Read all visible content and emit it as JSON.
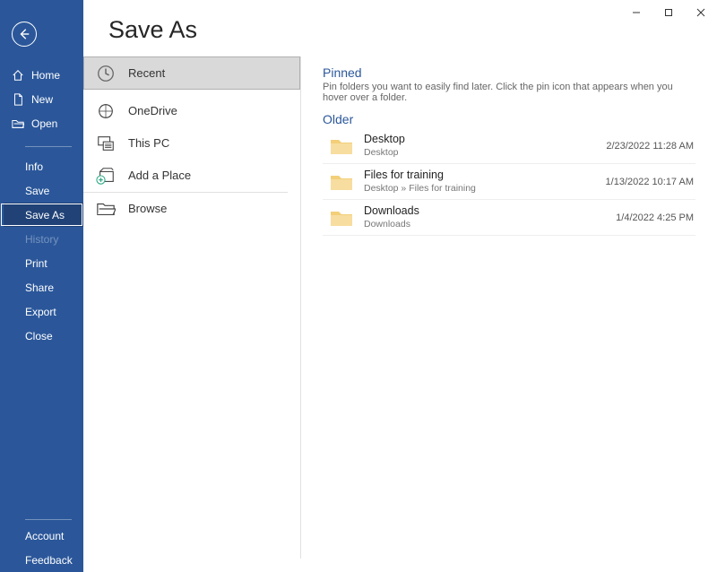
{
  "page_title": "Save As",
  "sidebar": {
    "top": [
      {
        "label": "Home",
        "icon": "home"
      },
      {
        "label": "New",
        "icon": "new"
      },
      {
        "label": "Open",
        "icon": "open"
      }
    ],
    "mid": [
      {
        "label": "Info",
        "state": ""
      },
      {
        "label": "Save",
        "state": ""
      },
      {
        "label": "Save As",
        "state": "selected"
      },
      {
        "label": "History",
        "state": "disabled"
      },
      {
        "label": "Print",
        "state": ""
      },
      {
        "label": "Share",
        "state": ""
      },
      {
        "label": "Export",
        "state": ""
      },
      {
        "label": "Close",
        "state": ""
      }
    ],
    "bottom": [
      {
        "label": "Account"
      },
      {
        "label": "Feedback"
      }
    ]
  },
  "locations": [
    {
      "label": "Recent",
      "icon": "clock",
      "selected": true
    },
    {
      "label": "OneDrive",
      "icon": "onedrive",
      "selected": false
    },
    {
      "label": "This PC",
      "icon": "thispc",
      "selected": false
    },
    {
      "label": "Add a Place",
      "icon": "addplace",
      "selected": false
    },
    {
      "label": "Browse",
      "icon": "browse",
      "selected": false
    }
  ],
  "pinned": {
    "heading": "Pinned",
    "hint": "Pin folders you want to easily find later. Click the pin icon that appears when you hover over a folder."
  },
  "older": {
    "heading": "Older",
    "items": [
      {
        "name": "Desktop",
        "path": "Desktop",
        "time": "2/23/2022 11:28 AM"
      },
      {
        "name": "Files for training",
        "path": "Desktop » Files for training",
        "time": "1/13/2022 10:17 AM"
      },
      {
        "name": "Downloads",
        "path": "Downloads",
        "time": "1/4/2022 4:25 PM"
      }
    ]
  }
}
